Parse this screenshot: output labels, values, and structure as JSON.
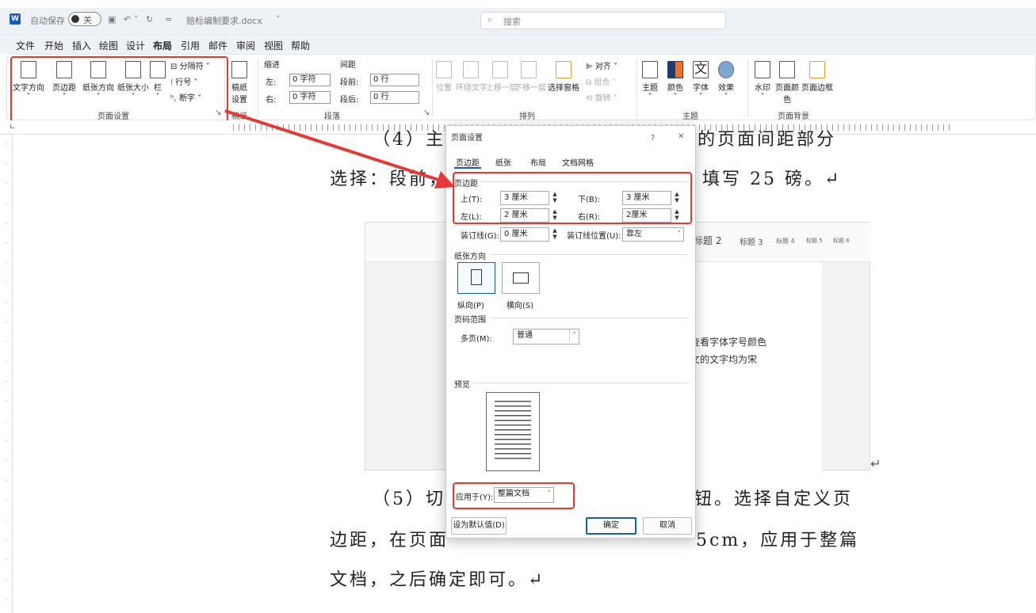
{
  "titlebar": {
    "autosave_label": "自动保存",
    "autosave_state": "关",
    "document_name": "赔标编制要求.docx",
    "search_placeholder": "搜索"
  },
  "menu": {
    "items": [
      "文件",
      "开始",
      "插入",
      "绘图",
      "设计",
      "布局",
      "引用",
      "邮件",
      "审阅",
      "视图",
      "帮助"
    ],
    "active": "布局"
  },
  "ribbon": {
    "page_setup": {
      "text_direction": "文字方向",
      "margins": "页边距",
      "orientation": "纸张方向",
      "size": "纸张大小",
      "columns": "栏",
      "breaks": "分隔符",
      "line_numbers": "行号",
      "hyphenation": "断字",
      "group_label": "页面设置"
    },
    "manuscript": {
      "button": "稿纸设置",
      "line1": "稿纸",
      "line2": "设置",
      "group_label": "稿纸"
    },
    "paragraph": {
      "indent_header": "缩进",
      "spacing_header": "间距",
      "left_label": "左:",
      "left_value": "0 字符",
      "right_label": "右:",
      "right_value": "0 字符",
      "before_label": "段前:",
      "before_value": "0 行",
      "after_label": "段后:",
      "after_value": "0 行",
      "group_label": "段落"
    },
    "arrange": {
      "position": "位置",
      "wrap_text": "环绕文字",
      "bring_forward": "上移一层",
      "send_backward": "下移一层",
      "selection_pane": "选择窗格",
      "align": "对齐",
      "group": "组合",
      "rotate": "旋转",
      "group_label": "排列"
    },
    "themes": {
      "theme": "主题",
      "colors": "颜色",
      "fonts": "字体",
      "effects": "效果",
      "glyph": "文",
      "group_label": "主题"
    },
    "page_background": {
      "watermark": "水印",
      "page_color": "页面颜色",
      "page_borders": "页面边框",
      "group_label": "页面背景"
    }
  },
  "document": {
    "line_top": "（4）主选",
    "line_top_right": "的页面间距部分",
    "line1_left": "选择：段前，",
    "line1_right": "填写 25 磅。↵",
    "line2_left": "（5）切换",
    "line2_right": "钮。选择自定义页",
    "line3_left": "边距，在页面",
    "line3_right": "5cm，应用于整篇",
    "line4": "文档，之后确定即可。↵",
    "embedded": {
      "style_h2": "标题 2",
      "style_h3": "标题 3",
      "style_h4": "标题 4",
      "style_h5": "标题 5",
      "style_h6": "标题 6",
      "text1": "查看字体字号颜色",
      "text2": "文的文字均为宋"
    }
  },
  "dialog": {
    "title": "页面设置",
    "help": "?",
    "close": "✕",
    "tabs": [
      "页边距",
      "纸张",
      "布局",
      "文档网格"
    ],
    "active_tab": "页边距",
    "margins_section": "页边距",
    "top_label": "上(T):",
    "top_value": "3 厘米",
    "bottom_label": "下(B):",
    "bottom_value": "3 厘米",
    "left_label": "左(L):",
    "left_value": "2 厘米",
    "right_label": "右(R):",
    "right_value": "2厘米",
    "gutter_label": "装订线(G):",
    "gutter_value": "0 厘米",
    "gutter_pos_label": "装订线位置(U):",
    "gutter_pos_value": "靠左",
    "orientation_section": "纸张方向",
    "portrait": "纵向(P)",
    "landscape": "横向(S)",
    "pages_section": "页码范围",
    "multiple_label": "多页(M):",
    "multiple_value": "普通",
    "preview_section": "预览",
    "apply_label": "应用于(Y):",
    "apply_value": "整篇文档",
    "default_button": "设为默认值(D)",
    "ok_button": "确定",
    "cancel_button": "取消"
  },
  "colors": {
    "accent": "#185abd",
    "annotation": "#e53935"
  }
}
